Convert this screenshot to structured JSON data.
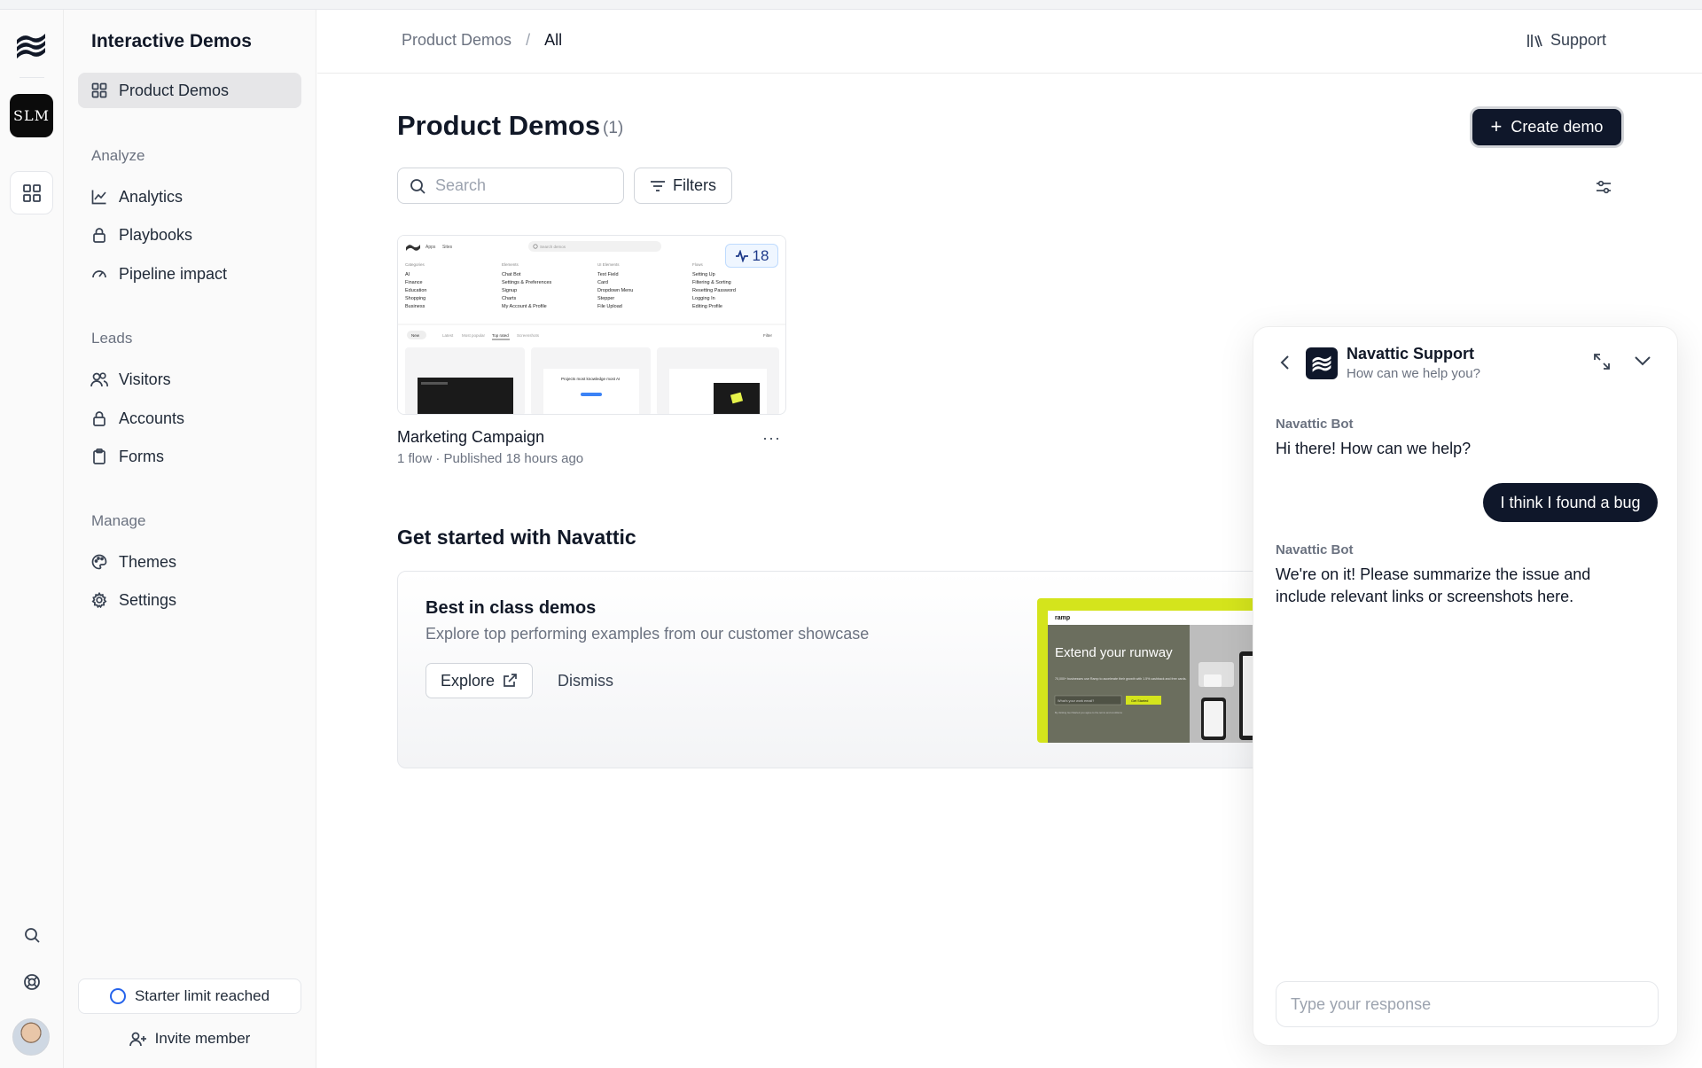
{
  "rail": {
    "workspace_badge": "SLM",
    "icons": [
      "navattic-logo-icon",
      "grid-icon",
      "search-icon",
      "help-icon"
    ]
  },
  "sidebar": {
    "title": "Interactive Demos",
    "primary": {
      "label": "Product Demos",
      "icon": "grid-icon"
    },
    "analyze": {
      "heading": "Analyze",
      "items": [
        {
          "label": "Analytics",
          "icon": "chart-line-icon"
        },
        {
          "label": "Playbooks",
          "icon": "lock-icon"
        },
        {
          "label": "Pipeline impact",
          "icon": "gauge-icon"
        }
      ]
    },
    "leads": {
      "heading": "Leads",
      "items": [
        {
          "label": "Visitors",
          "icon": "users-icon"
        },
        {
          "label": "Accounts",
          "icon": "lock-icon"
        },
        {
          "label": "Forms",
          "icon": "clipboard-icon"
        }
      ]
    },
    "manage": {
      "heading": "Manage",
      "items": [
        {
          "label": "Themes",
          "icon": "palette-icon"
        },
        {
          "label": "Settings",
          "icon": "gear-icon"
        }
      ]
    },
    "limit_label": "Starter limit reached",
    "invite_label": "Invite member"
  },
  "header": {
    "breadcrumb": [
      "Product Demos",
      "All"
    ],
    "breadcrumb_sep": "/",
    "support_label": "Support"
  },
  "main": {
    "title": "Product Demos",
    "count": "(1)",
    "create_label": "Create demo",
    "search_placeholder": "Search",
    "filters_label": "Filters",
    "demo": {
      "name": "Marketing Campaign",
      "meta": "1 flow · Published 18 hours ago",
      "views": "18",
      "more": "···",
      "thumbnail": {
        "nav": [
          "Apps",
          "Sites"
        ],
        "search_placeholder": "Search demos",
        "columns": [
          {
            "heading": "Categories",
            "items": [
              "AI",
              "Finance",
              "Education",
              "Shopping",
              "Business"
            ]
          },
          {
            "heading": "Elements",
            "items": [
              "Chat Bot",
              "Settings & Preferences",
              "Signup",
              "Charts",
              "My Account & Profile"
            ]
          },
          {
            "heading": "UI Elements",
            "items": [
              "Text Field",
              "Card",
              "Dropdown Menu",
              "Stepper",
              "File Upload"
            ]
          },
          {
            "heading": "Flows",
            "items": [
              "Setting Up",
              "Filtering & Sorting",
              "Resetting Password",
              "Logging In",
              "Editing Profile"
            ]
          }
        ],
        "tabs": [
          "New",
          "Latest",
          "Most popular",
          "Top rated",
          "Screenshots"
        ],
        "filter_label": "Filter",
        "preview_headline": "Projects most knowledge most AI"
      }
    },
    "get_started": {
      "title": "Get started with Navattic",
      "card_title": "Best in class demos",
      "card_subtitle": "Explore top performing examples from our customer showcase",
      "explore_label": "Explore",
      "dismiss_label": "Dismiss",
      "image": {
        "brand": "ramp",
        "headline": "Extend your runway",
        "body": "70,000+ businesses use Ramp to accelerate their growth with 1.5% cashback and free cards.",
        "email_placeholder": "What's your work email?",
        "cta": "Get Started",
        "footnote": "By clicking Get Started you agree to the terms and conditions"
      }
    }
  },
  "chat": {
    "title": "Navattic Support",
    "subtitle": "How can we help you?",
    "messages": [
      {
        "sender": "Navattic Bot",
        "text": "Hi there! How can we help?"
      },
      {
        "sender": "user",
        "text": "I think I found a bug"
      },
      {
        "sender": "Navattic Bot",
        "text": "We're on it! Please summarize the issue and include relevant links or screenshots here."
      }
    ],
    "input_placeholder": "Type your response"
  },
  "colors": {
    "accent_dark": "#0f172a",
    "active_nav_bg": "#e6e6e8",
    "limit_ring": "#2563eb",
    "views_badge": "#eff6ff",
    "showcase_accent": "#d4e41c"
  }
}
